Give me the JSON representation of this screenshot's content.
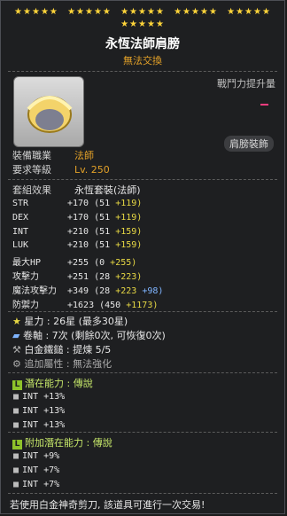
{
  "item": {
    "stars_row1": "★★★★★",
    "title": "永恆法師肩膀",
    "subtitle": "無法交換",
    "damage_label": "戰鬥力提升量",
    "slot_button": "肩膀裝飾"
  },
  "requirements": {
    "job_label": "裝備職業",
    "job_value": "法師",
    "level_label": "要求等級",
    "level_value": "Lv. 250"
  },
  "set_effect": {
    "label": "套組效果",
    "value": "永恆套裝(法師)"
  },
  "stats": [
    {
      "name": "STR",
      "total": "+170",
      "base": "(51",
      "bonus": "+119)"
    },
    {
      "name": "DEX",
      "total": "+170",
      "base": "(51",
      "bonus": "+119)"
    },
    {
      "name": "INT",
      "total": "+210",
      "base": "(51",
      "bonus": "+159)"
    },
    {
      "name": "LUK",
      "total": "+210",
      "base": "(51",
      "bonus": "+159)"
    },
    {
      "name": "最大HP",
      "total": "+255",
      "base": "(0",
      "bonus": "+255)"
    },
    {
      "name": "攻擊力",
      "total": "+251",
      "base": "(28",
      "bonus": "+223)"
    },
    {
      "name": "魔法攻擊力",
      "total": "+349",
      "base": "(28",
      "bonus": "+223",
      "bonus2": "+98)"
    },
    {
      "name": "防禦力",
      "total": "+1623",
      "base": "(450",
      "bonus": "+1173)"
    }
  ],
  "extra": {
    "stars_label": "星力",
    "stars_value": ": 26星 (最多30星)",
    "scroll_label": "卷軸",
    "scroll_value": ": 7次 (剩餘0次, 可恢復0次)",
    "hammer_label": "白金鐵鎚",
    "hammer_value": ": 提煉 5/5",
    "extra_label": "追加屬性",
    "extra_value": ": 無法強化"
  },
  "potential": {
    "title": "潛在能力 : 傳說",
    "lines": [
      "INT +13%",
      "INT +13%",
      "INT +13%"
    ]
  },
  "bonus_potential": {
    "title": "附加潛在能力 : 傳說",
    "lines": [
      "INT +9%",
      "INT +7%",
      "INT +7%"
    ]
  },
  "footer": "若使用白金神奇剪刀, 該道具可進行一次交易!",
  "colors": {
    "gold": "#e3a128",
    "yellow": "#e7d844",
    "blue": "#7fb4ff",
    "green": "#8ec22a"
  }
}
